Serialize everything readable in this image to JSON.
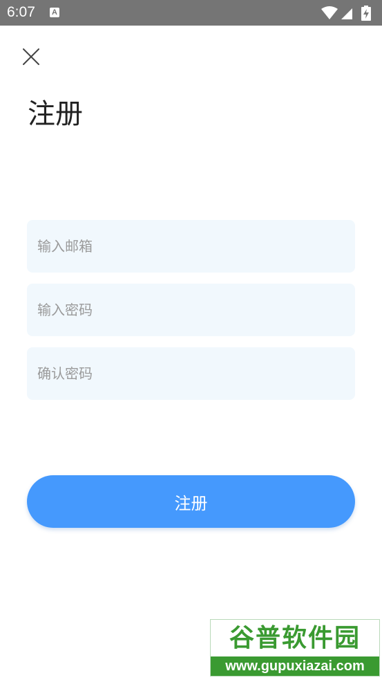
{
  "status_bar": {
    "time": "6:07",
    "notification_glyph": "A",
    "icons": [
      "wifi-icon",
      "signal-icon",
      "battery-charging-icon"
    ]
  },
  "header": {
    "close_icon": "close-icon",
    "title": "注册"
  },
  "form": {
    "email": {
      "placeholder": "输入邮箱",
      "value": ""
    },
    "password": {
      "placeholder": "输入密码",
      "value": ""
    },
    "confirm_password": {
      "placeholder": "确认密码",
      "value": ""
    },
    "submit_label": "注册"
  },
  "watermark": {
    "title": "谷普软件园",
    "url": "www.gupuxiazai.com"
  },
  "colors": {
    "status_bar": "#757575",
    "field_background": "#f1f8fd",
    "primary_button": "#4599fd",
    "watermark_green": "#3a9a31"
  }
}
